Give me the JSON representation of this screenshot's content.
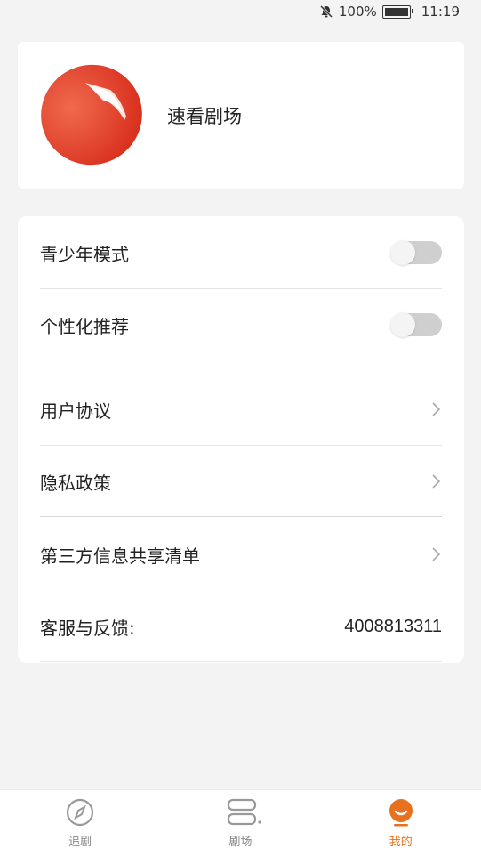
{
  "status_bar": {
    "battery": "100%",
    "time": "11:19",
    "icons": [
      "mute-bell-icon",
      "battery-icon"
    ]
  },
  "profile": {
    "app_name": "速看剧场",
    "logo_icon": "app-logo-icon",
    "brand_color": "#e23b24"
  },
  "settings": {
    "teen_mode": {
      "label": "青少年模式",
      "enabled": false
    },
    "personalized": {
      "label": "个性化推荐",
      "enabled": false
    },
    "user_agreement": {
      "label": "用户协议"
    },
    "privacy_policy": {
      "label": "隐私政策"
    },
    "third_party": {
      "label": "第三方信息共享清单"
    },
    "support": {
      "label": "客服与反馈:",
      "phone": "4008813311"
    }
  },
  "bottom_nav": {
    "items": [
      {
        "label": "追剧",
        "icon": "compass-icon",
        "active": false
      },
      {
        "label": "剧场",
        "icon": "theater-icon",
        "active": false
      },
      {
        "label": "我的",
        "icon": "profile-smile-icon",
        "active": true
      }
    ],
    "active_color": "#e8711f"
  }
}
